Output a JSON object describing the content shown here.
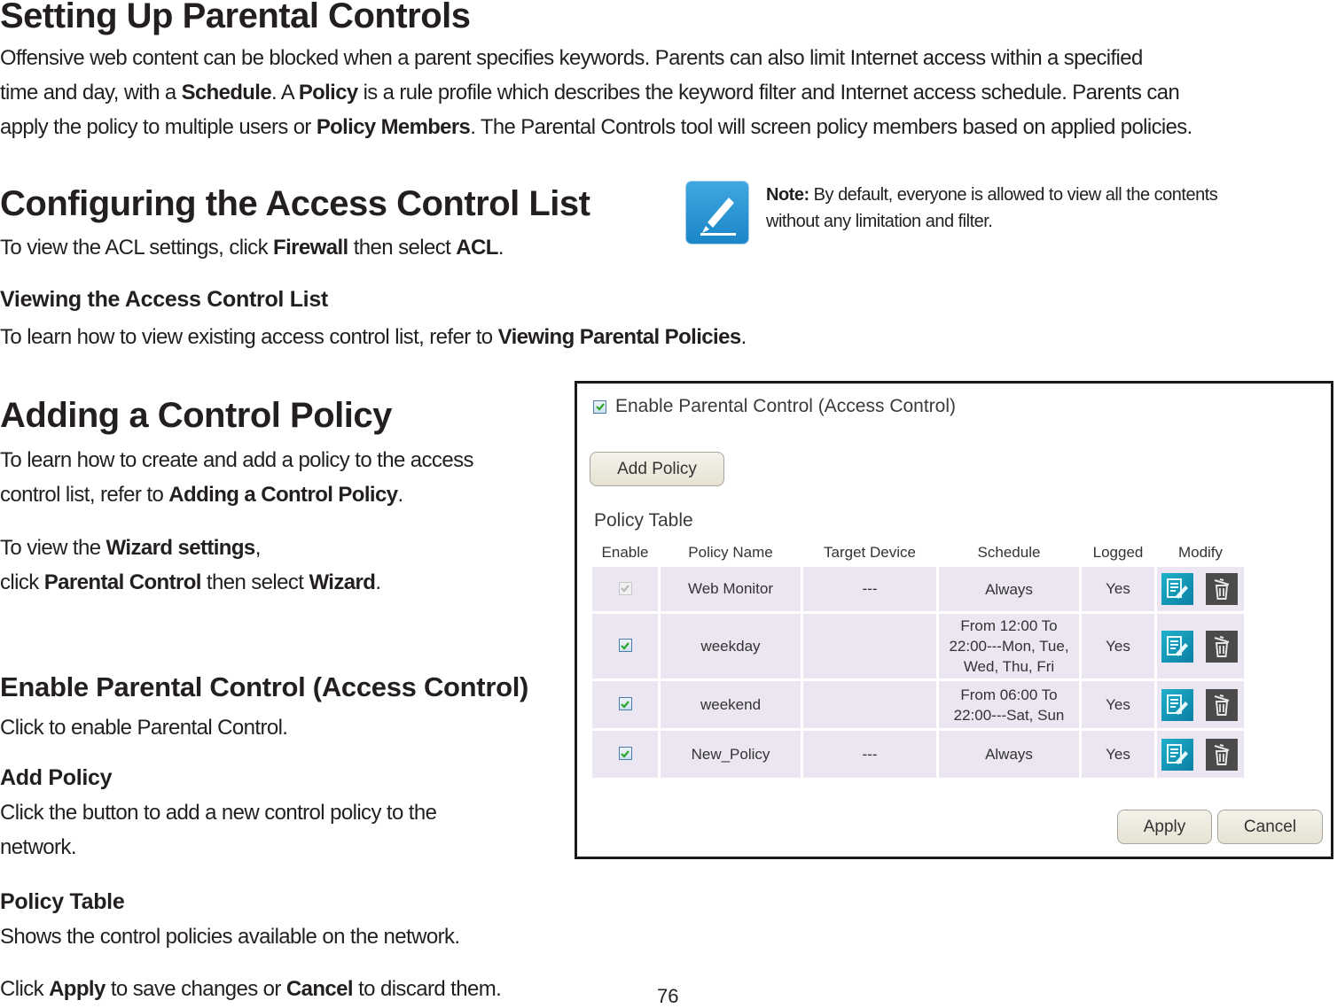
{
  "page": {
    "number": "76"
  },
  "section_setup": {
    "title": "Setting Up Parental Controls",
    "paragraph": [
      [
        {
          "t": "Offensive web content can be blocked when a parent specifies keywords. Parents can also limit Internet access within a specified"
        }
      ],
      [
        {
          "t": "time and day, with a "
        },
        {
          "b": "Schedule"
        },
        {
          "t": ". A "
        },
        {
          "b": "Policy"
        },
        {
          "t": " is a rule profile which describes the keyword filter and Internet access schedule. Parents can"
        }
      ],
      [
        {
          "t": "apply the policy to multiple users or "
        },
        {
          "b": "Policy Members"
        },
        {
          "t": ". The Parental Controls tool will screen policy members based on applied policies."
        }
      ]
    ]
  },
  "section_acl": {
    "title": "Configuring the Access Control List",
    "intro_prefix": "To view the ACL settings, click ",
    "intro_bold1": "Firewall",
    "intro_mid": " then select ",
    "intro_bold2": "ACL",
    "intro_suffix": ".",
    "subheading": "Viewing the Access Control List",
    "sub_prefix": "To learn how to view existing access control list, refer to ",
    "sub_bold": "Viewing Parental Policies",
    "sub_suffix": "."
  },
  "note": {
    "label": "Note:",
    "line1": " By default, everyone is allowed to view all the contents",
    "line2": "without any limitation and filter.",
    "icon": "pencil-note-icon",
    "icon_color": "#2a97d6"
  },
  "section_add": {
    "title": "Adding a Control Policy",
    "line1": "To learn how to create and add a policy to the access",
    "line2_prefix": "control list, refer to ",
    "line2_bold": "Adding a Control Policy",
    "line2_suffix": ".",
    "wizard_prefix": "To view the ",
    "wizard_bold": "Wizard settings",
    "wizard_suffix": ",",
    "click_prefix": "click ",
    "click_bold1": "Parental Control",
    "click_mid": " then select ",
    "click_bold2": "Wizard",
    "click_suffix": "."
  },
  "section_enable": {
    "title": "Enable Parental Control (Access Control)",
    "desc": "Click to enable Parental Control.",
    "add_heading": "Add Policy",
    "add_line1": "Click the button to add a new control policy to the",
    "add_line2": "network.",
    "table_heading": "Policy Table",
    "table_desc": "Shows the control policies available on the network.",
    "final_prefix": "Click ",
    "final_bold1": "Apply",
    "final_mid": " to save changes or ",
    "final_bold2": "Cancel",
    "final_suffix": " to discard them."
  },
  "screenshot": {
    "enable_label": "Enable Parental Control (Access Control)",
    "enable_checked": true,
    "add_policy_label": "Add Policy",
    "table_title": "Policy Table",
    "columns": [
      "Enable",
      "Policy Name",
      "Target Device",
      "Schedule",
      "Logged",
      "Modify"
    ],
    "rows": [
      {
        "enabled": true,
        "disabled": true,
        "name": "Web Monitor",
        "target": "---",
        "schedule": [
          "Always"
        ],
        "logged": "Yes"
      },
      {
        "enabled": true,
        "disabled": false,
        "name": "weekday",
        "target": "",
        "schedule": [
          "From 12:00 To",
          "22:00---Mon, Tue,",
          "Wed, Thu, Fri"
        ],
        "logged": "Yes"
      },
      {
        "enabled": true,
        "disabled": false,
        "name": "weekend",
        "target": "",
        "schedule": [
          "From 06:00 To",
          "22:00---Sat, Sun"
        ],
        "logged": "Yes"
      },
      {
        "enabled": true,
        "disabled": false,
        "name": "New_Policy",
        "target": "---",
        "schedule": [
          "Always"
        ],
        "logged": "Yes"
      }
    ],
    "apply_label": "Apply",
    "cancel_label": "Cancel",
    "colors": {
      "cell_bg": "#ebe6f2",
      "edit_icon": "#13a0bf",
      "delete_icon": "#4a4a4a",
      "check": "#2aa52a"
    }
  }
}
